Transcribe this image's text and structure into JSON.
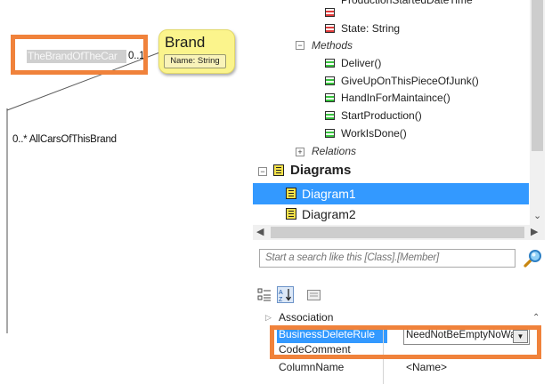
{
  "diagram": {
    "role_name_edit": "TheBrandOfTheCar",
    "source_multiplicity": "0..1",
    "target_role": "0..* AllCarsOfThisBrand",
    "brand_box": {
      "title": "Brand",
      "attribute": "Name: String"
    },
    "colors": {
      "highlight": "#f0823b",
      "class_fill": "#fbf48c"
    }
  },
  "tree": {
    "items": [
      {
        "label": "ProductionStartedDateTime",
        "kind": "attribute",
        "partially_visible": true
      },
      {
        "label": "State: String",
        "kind": "attribute"
      },
      {
        "label": "Methods",
        "kind": "group",
        "expanded": true
      },
      {
        "label": "Deliver()",
        "kind": "method"
      },
      {
        "label": "GiveUpOnThisPieceOfJunk()",
        "kind": "method"
      },
      {
        "label": "HandInForMaintaince()",
        "kind": "method"
      },
      {
        "label": "StartProduction()",
        "kind": "method"
      },
      {
        "label": "WorkIsDone()",
        "kind": "method"
      },
      {
        "label": "Relations",
        "kind": "group",
        "expanded": false
      },
      {
        "label": "Diagrams",
        "kind": "root",
        "expanded": true
      },
      {
        "label": "Diagram1",
        "kind": "diagram",
        "selected": true
      },
      {
        "label": "Diagram2",
        "kind": "diagram"
      }
    ]
  },
  "search": {
    "placeholder": "Start a search like this [Class].[Member]"
  },
  "toolbar": {
    "categorized_icon": "categorized-view-icon",
    "alphabetical_icon": "sort-alphabetical-icon",
    "property_pages_icon": "property-pages-icon"
  },
  "properties": {
    "rows": [
      {
        "name": "Association",
        "value": "",
        "expandable": true
      },
      {
        "name": "BusinessDeleteRule",
        "value": "NeedNotBeEmptyNoWar",
        "selected": true
      },
      {
        "name": "CodeComment",
        "value": ""
      },
      {
        "name": "ColumnName",
        "value": "<Name>"
      }
    ]
  }
}
